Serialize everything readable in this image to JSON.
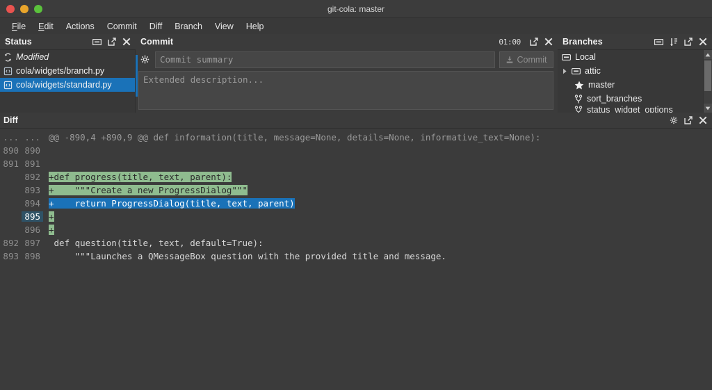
{
  "window": {
    "title": "git-cola: master",
    "controls": [
      "close-dot",
      "minimize-dot",
      "maximize-dot"
    ]
  },
  "menubar": {
    "items": [
      {
        "label": "File",
        "mnemonic": "F"
      },
      {
        "label": "Edit",
        "mnemonic": "E"
      },
      {
        "label": "Actions",
        "mnemonic": ""
      },
      {
        "label": "Commit",
        "mnemonic": ""
      },
      {
        "label": "Diff",
        "mnemonic": ""
      },
      {
        "label": "Branch",
        "mnemonic": ""
      },
      {
        "label": "View",
        "mnemonic": ""
      },
      {
        "label": "Help",
        "mnemonic": ""
      }
    ]
  },
  "status_panel": {
    "title": "Status",
    "icons": [
      "minimize-icon",
      "detach-icon",
      "close-icon"
    ],
    "rows": [
      {
        "label": "Modified",
        "icon": "sync-arrows-icon",
        "type": "group",
        "selected": false
      },
      {
        "label": "cola/widgets/branch.py",
        "icon": "code-file-icon",
        "type": "file",
        "selected": false
      },
      {
        "label": "cola/widgets/standard.py",
        "icon": "code-file-icon",
        "type": "file",
        "selected": true
      }
    ]
  },
  "commit_panel": {
    "title": "Commit",
    "clock": "01:00",
    "icons": [
      "detach-icon",
      "close-icon"
    ],
    "options_icon": "gear-icon",
    "summary_placeholder": "Commit summary",
    "summary_value": "",
    "description_placeholder": "Extended description...",
    "description_value": "",
    "commit_button": {
      "label": "Commit",
      "icon": "commit-icon",
      "enabled": false
    }
  },
  "branches_panel": {
    "title": "Branches",
    "icons": [
      "minimize-icon",
      "sort-icon",
      "detach-icon",
      "close-icon"
    ],
    "rows": [
      {
        "label": "Local",
        "icon": "branch-group-icon",
        "indent": 0,
        "expander": "",
        "clipped": false
      },
      {
        "label": "attic",
        "icon": "branch-group-icon",
        "indent": 1,
        "expander": "collapsed",
        "clipped": false
      },
      {
        "label": "master",
        "icon": "star-icon",
        "indent": 1,
        "expander": "",
        "clipped": false
      },
      {
        "label": "sort_branches",
        "icon": "branch-icon",
        "indent": 1,
        "expander": "",
        "clipped": false
      },
      {
        "label": "status_widget_options",
        "icon": "branch-icon",
        "indent": 1,
        "expander": "",
        "clipped": true
      }
    ],
    "scrollbar": {
      "up": "scroll-up-arrow",
      "down": "scroll-down-arrow"
    }
  },
  "diff_panel": {
    "title": "Diff",
    "icons": [
      "gear-icon",
      "detach-icon",
      "close-icon"
    ],
    "hunk_header": {
      "old_gutter": "...",
      "new_gutter": "...",
      "text": "@@ -890,4 +890,9 @@ def information(title, message=None, details=None, informative_text=None):"
    },
    "lines": [
      {
        "old": "890",
        "new": "890",
        "text": "",
        "kind": "context",
        "gutter_highlight": false
      },
      {
        "old": "891",
        "new": "891",
        "text": "",
        "kind": "context",
        "gutter_highlight": false
      },
      {
        "old": "",
        "new": "892",
        "text": "+def progress(title, text, parent):",
        "kind": "added",
        "gutter_highlight": false
      },
      {
        "old": "",
        "new": "893",
        "text": "+    \"\"\"Create a new ProgressDialog\"\"\"",
        "kind": "added",
        "gutter_highlight": false
      },
      {
        "old": "",
        "new": "894",
        "text": "+    return ProgressDialog(title, text, parent)",
        "kind": "added-selected",
        "gutter_highlight": false
      },
      {
        "old": "",
        "new": "895",
        "text": "+",
        "kind": "added",
        "gutter_highlight": true
      },
      {
        "old": "",
        "new": "896",
        "text": "+",
        "kind": "added",
        "gutter_highlight": false
      },
      {
        "old": "892",
        "new": "897",
        "text": " def question(title, text, default=True):",
        "kind": "context",
        "gutter_highlight": false
      },
      {
        "old": "893",
        "new": "898",
        "text": "     \"\"\"Launches a QMessageBox question with the provided title and message.",
        "kind": "context",
        "gutter_highlight": false
      }
    ]
  },
  "colors": {
    "window_bg": "#3b3b3b",
    "panel_bg": "#383838",
    "selection_blue": "#1a72b8",
    "diff_add_green": "#8fbc8f",
    "gutter_highlight": "#2f5266",
    "titlebar": "#3c3c3c"
  }
}
